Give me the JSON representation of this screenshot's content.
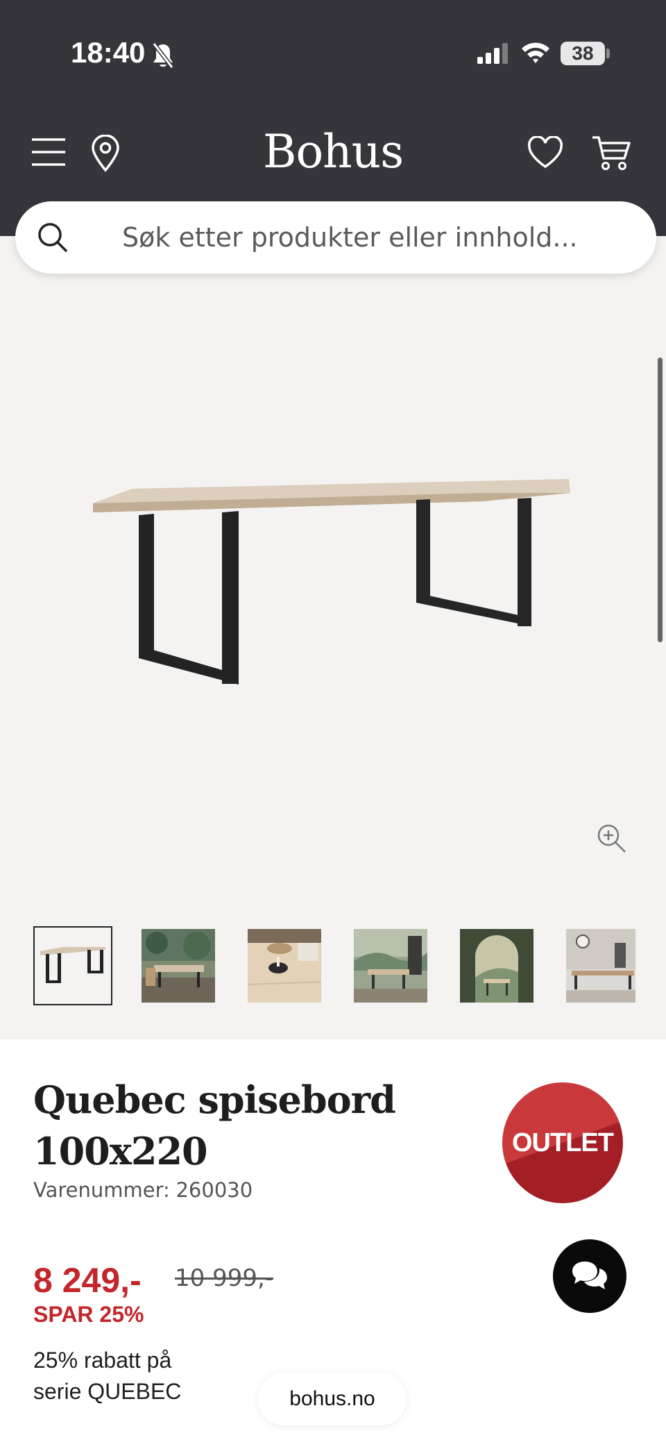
{
  "status_bar": {
    "time": "18:40",
    "battery": "38"
  },
  "header": {
    "logo": "Bohus",
    "menu_icon": "hamburger-icon",
    "location_icon": "map-pin-icon",
    "favorites_icon": "heart-icon",
    "cart_icon": "shopping-cart-icon"
  },
  "search": {
    "placeholder": "Søk etter produkter eller innhold...",
    "icon": "search-icon"
  },
  "gallery": {
    "zoom_icon": "zoom-in-icon",
    "thumbnails": [
      "table-product",
      "dining-room-green-wall",
      "tabletop-closeup",
      "dining-room-landscape",
      "arched-alcove-dining",
      "long-table-room"
    ],
    "active_thumbnail": 0
  },
  "product": {
    "title_line1": "Quebec spisebord",
    "title_line2": "100x220",
    "sku_label": "Varenummer:",
    "sku": "260030",
    "badge": "OUTLET",
    "price_now": "8 249,-",
    "price_before": "10 999,-",
    "saving": "SPAR 25%",
    "campaign_line1": "25% rabatt på",
    "campaign_line2": "serie QUEBEC"
  },
  "colors": {
    "header_bg": "#35353b",
    "sale_red": "#c3262b",
    "gallery_bg": "#f5f3f1"
  },
  "chat": {
    "icon": "chat-bubbles-icon"
  },
  "browser": {
    "domain": "bohus.no"
  }
}
